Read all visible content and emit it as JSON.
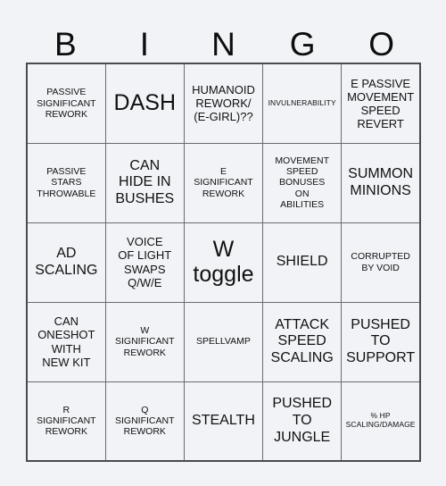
{
  "card": {
    "title_letters": [
      "B",
      "I",
      "N",
      "G",
      "O"
    ],
    "rows": [
      [
        {
          "text": "PASSIVE\nSIGNIFICANT\nREWORK",
          "size": "sm"
        },
        {
          "text": "DASH",
          "size": "xl"
        },
        {
          "text": "HUMANOID\nREWORK/\n(E-GIRL)??",
          "size": "md"
        },
        {
          "text": "INVULNERABILITY",
          "size": "xs"
        },
        {
          "text": "E PASSIVE\nMOVEMENT\nSPEED\nREVERT",
          "size": "md"
        }
      ],
      [
        {
          "text": "PASSIVE\nSTARS\nTHROWABLE",
          "size": "sm"
        },
        {
          "text": "CAN\nHIDE IN\nBUSHES",
          "size": "lg"
        },
        {
          "text": "E\nSIGNIFICANT\nREWORK",
          "size": "sm"
        },
        {
          "text": "MOVEMENT\nSPEED\nBONUSES\nON\nABILITIES",
          "size": "sm"
        },
        {
          "text": "SUMMON\nMINIONS",
          "size": "lg"
        }
      ],
      [
        {
          "text": "AD\nSCALING",
          "size": "lg"
        },
        {
          "text": "VOICE\nOF LIGHT\nSWAPS\nQ/W/E",
          "size": "md"
        },
        {
          "text": "W\ntoggle",
          "size": "xl"
        },
        {
          "text": "SHIELD",
          "size": "lg"
        },
        {
          "text": "CORRUPTED\nBY VOID",
          "size": "sm"
        }
      ],
      [
        {
          "text": "CAN\nONESHOT\nWITH\nNEW KIT",
          "size": "md"
        },
        {
          "text": "W\nSIGNIFICANT\nREWORK",
          "size": "sm"
        },
        {
          "text": "SPELLVAMP",
          "size": "sm"
        },
        {
          "text": "ATTACK\nSPEED\nSCALING",
          "size": "lg"
        },
        {
          "text": "PUSHED\nTO\nSUPPORT",
          "size": "lg"
        }
      ],
      [
        {
          "text": "R\nSIGNIFICANT\nREWORK",
          "size": "sm"
        },
        {
          "text": "Q\nSIGNIFICANT\nREWORK",
          "size": "sm"
        },
        {
          "text": "STEALTH",
          "size": "lg"
        },
        {
          "text": "PUSHED\nTO\nJUNGLE",
          "size": "lg"
        },
        {
          "text": "% HP\nSCALING/DAMAGE",
          "size": "xs"
        }
      ]
    ]
  },
  "colors": {
    "background": "#f1f3f6",
    "text": "#111111",
    "outer_border": "#4a4a52",
    "inner_border": "#6a6a72"
  }
}
